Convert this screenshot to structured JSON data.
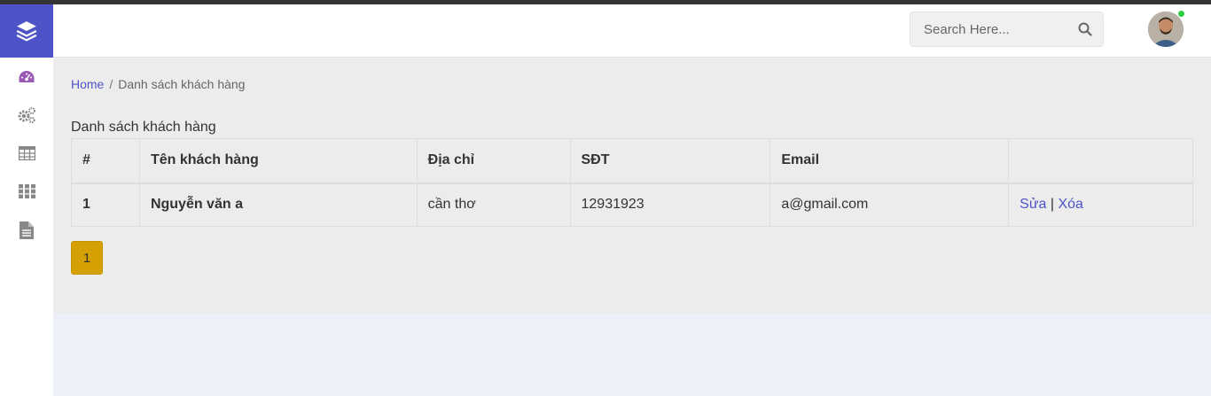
{
  "header": {
    "search": {
      "placeholder": "Search Here..."
    },
    "avatar_online": true
  },
  "sidebar": {
    "items": [
      {
        "icon": "dashboard-icon",
        "color": "#9b59b6"
      },
      {
        "icon": "gears-icon",
        "color": "#888888"
      },
      {
        "icon": "table-icon",
        "color": "#888888"
      },
      {
        "icon": "grid-icon",
        "color": "#888888"
      },
      {
        "icon": "document-icon",
        "color": "#888888"
      }
    ]
  },
  "breadcrumb": {
    "home": "Home",
    "separator": "/",
    "current": "Danh sách khách hàng"
  },
  "section_title": "Danh sách khách hàng",
  "table": {
    "headers": [
      "#",
      "Tên khách hàng",
      "Địa chỉ",
      "SĐT",
      "Email",
      ""
    ],
    "rows": [
      {
        "index": "1",
        "name": "Nguyễn văn a",
        "address": "cần thơ",
        "phone": "12931923",
        "email": "a@gmail.com",
        "edit": "Sửa",
        "divider": "|",
        "delete": "Xóa"
      }
    ]
  },
  "pagination": {
    "current_page": "1"
  },
  "colors": {
    "accent": "#4e54c8",
    "page_button": "#d4a003",
    "online": "#2ecc40"
  }
}
